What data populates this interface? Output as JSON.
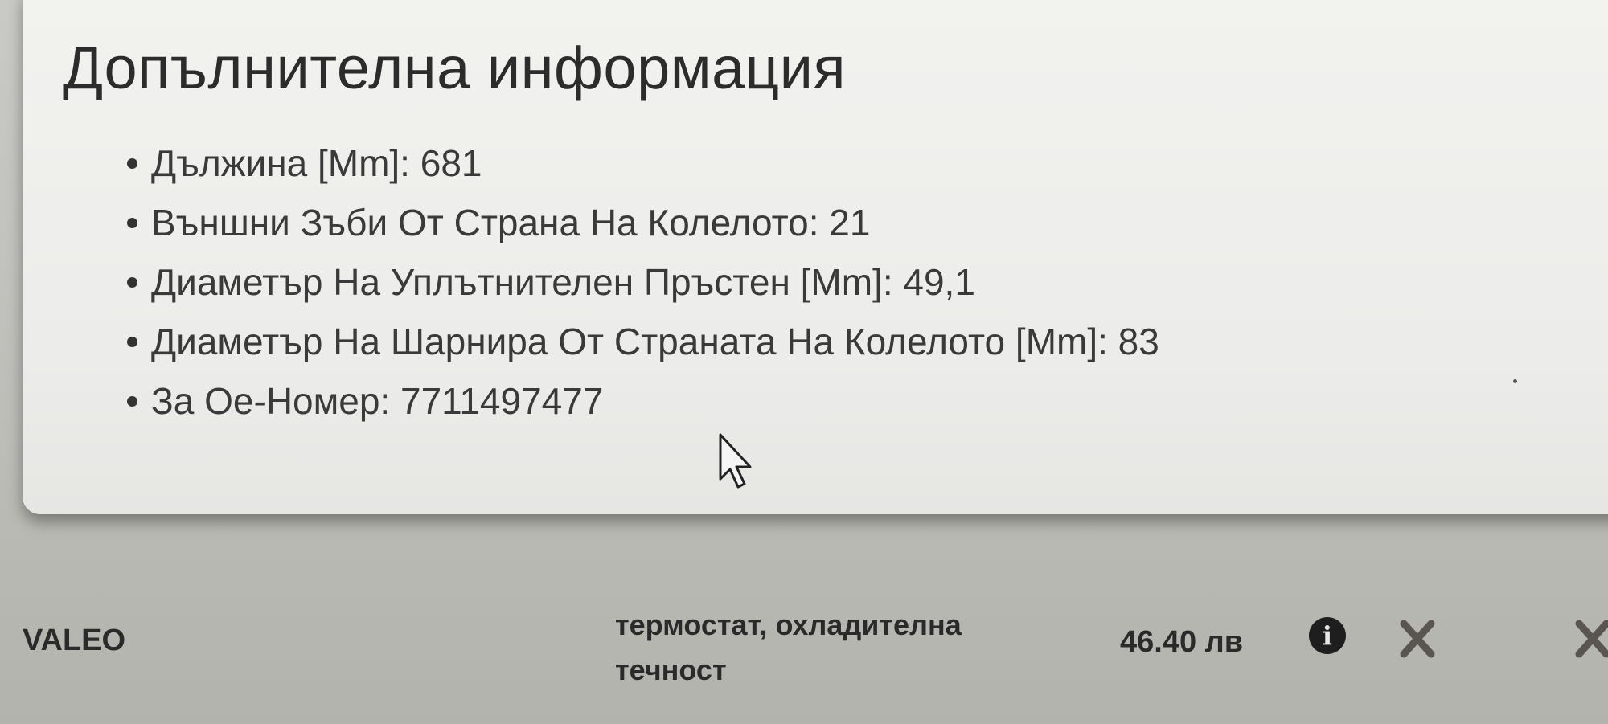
{
  "info_panel": {
    "title": "Допълнителна информация",
    "items": [
      {
        "label": "Дължина [Mm]: 681"
      },
      {
        "label": "Външни Зъби От Страна На Колелото: 21"
      },
      {
        "label": "Диаметър На Уплътнителен Пръстен [Mm]: 49,1"
      },
      {
        "label": "Диаметър На Шарнира От Страната На Колелото [Mm]: 83"
      },
      {
        "label": "За Ое-Номер: 7711497477"
      }
    ]
  },
  "product_row": {
    "brand": "VALEO",
    "description": "термостат, охладителна течност",
    "price": "46.40 лв",
    "info_icon": "info-icon",
    "remove_icons": [
      "close-icon",
      "close-icon"
    ]
  },
  "colors": {
    "panel_bg": "#ececea",
    "page_bg": "#c4c4c0",
    "text_dark": "#2c2c2c",
    "remove_icon": "#5a5550"
  }
}
